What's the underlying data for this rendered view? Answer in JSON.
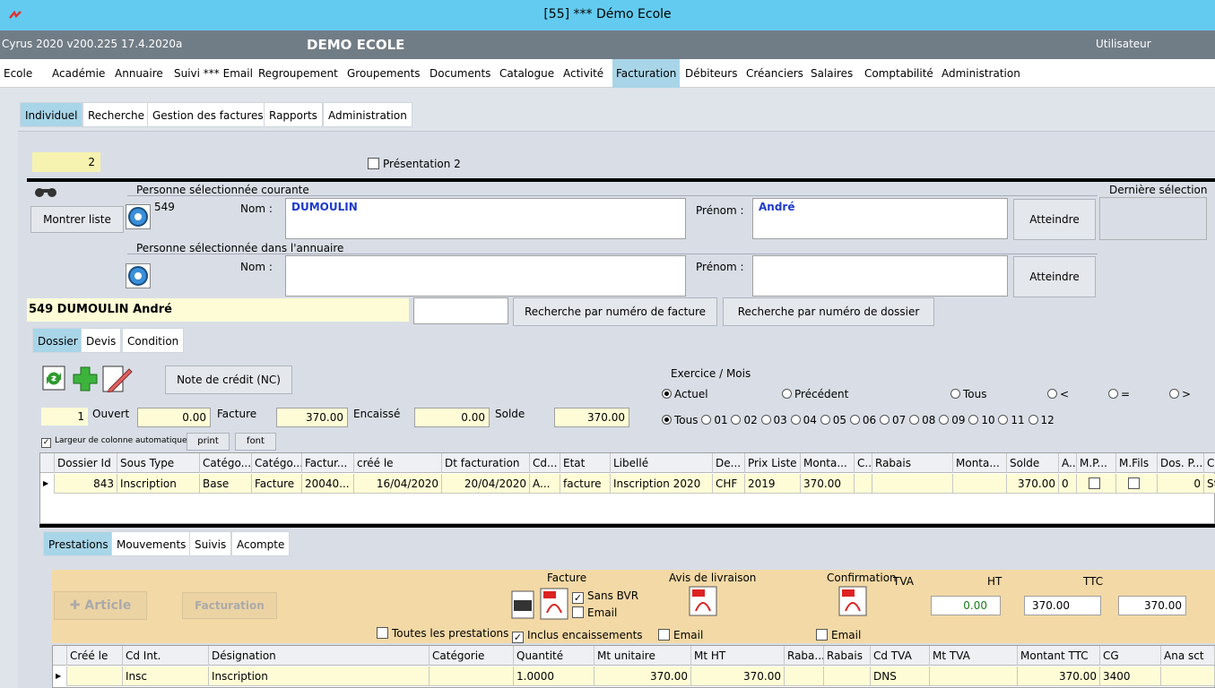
{
  "window": {
    "title": "[55] *** Démo Ecole"
  },
  "app": {
    "version": "Cyrus 2020 v200.225 17.4.2020a",
    "school": "DEMO ECOLE",
    "user": "Utilisateur"
  },
  "menu": [
    "Ecole",
    "Académie",
    "Annuaire",
    "Suivi *** Email",
    "Regroupement",
    "Groupements",
    "Documents",
    "Catalogue",
    "Activité",
    "Facturation",
    "Débiteurs",
    "Créanciers",
    "Salaires",
    "Comptabilité",
    "Administration"
  ],
  "subtabs": [
    "Individuel",
    "Recherche",
    "Gestion des factures",
    "Rapports",
    "Administration"
  ],
  "counter": "2",
  "presentation2": "Présentation 2",
  "current": {
    "group": "Personne sélectionnée courante",
    "id": "549",
    "nom_label": "Nom :",
    "nom": "DUMOULIN",
    "prenom_label": "Prénom :",
    "prenom": "André",
    "goto": "Atteindre",
    "show_list": "Montrer liste"
  },
  "last_selection": "Dernière sélection",
  "annuaire": {
    "group": "Personne sélectionnée dans l'annuaire",
    "nom_label": "Nom :",
    "nom": "",
    "prenom_label": "Prénom :",
    "prenom": "",
    "goto": "Atteindre"
  },
  "person_banner": "549 DUMOULIN André",
  "search_invoice": "Recherche par numéro de facture",
  "search_dossier": "Recherche par numéro de dossier",
  "dtabs": [
    "Dossier",
    "Devis",
    "Condition"
  ],
  "credit_note": "Note de crédit (NC)",
  "summary": {
    "count": "1",
    "ouvert_label": "Ouvert",
    "ouvert": "0.00",
    "facture_label": "Facture",
    "facture": "370.00",
    "encaisse_label": "Encaissé",
    "encaisse": "0.00",
    "solde_label": "Solde",
    "solde": "370.00"
  },
  "exercise": {
    "title": "Exercice / Mois",
    "opts1": [
      "Actuel",
      "Précédent",
      "Tous",
      "<",
      "=",
      ">"
    ],
    "opts2": [
      "Tous",
      "01",
      "02",
      "03",
      "04",
      "05",
      "06",
      "07",
      "08",
      "09",
      "10",
      "11",
      "12"
    ]
  },
  "auto_width": "Largeur de colonne automatique",
  "print": "print",
  "font": "font",
  "grid1": {
    "headers": [
      "Dossier Id",
      "Sous Type",
      "Catégo...",
      "Catégo...",
      "Factur...",
      "créé le",
      "Dt facturation",
      "Cd...",
      "Etat",
      "Libellé",
      "De...",
      "Prix Liste",
      "Monta...",
      "C..",
      "Rabais",
      "Monta...",
      "Solde",
      "A..",
      "M.P...",
      "M.Fils",
      "Dos. P...",
      "Cal..."
    ],
    "rows": [
      [
        "843",
        "Inscription",
        "Base",
        "Facture",
        "20040...",
        "16/04/2020",
        "20/04/2020",
        "A...",
        "facture",
        "Inscription 2020",
        "CHF",
        "2019",
        "370.00",
        "",
        "",
        "",
        "370.00",
        "0",
        "",
        "",
        "0",
        "Stan..."
      ]
    ]
  },
  "ptabs": [
    "Prestations",
    "Mouvements",
    "Suivis",
    "Acompte"
  ],
  "prest": {
    "article": "Article",
    "facturation": "Facturation",
    "all": "Toutes les prestations",
    "facture_group": "Facture",
    "sans_bvr": "Sans BVR",
    "email": "Email",
    "inclus": "Inclus encaissements",
    "avis": "Avis de livraison",
    "email2": "Email",
    "confirmation": "Confirmation",
    "email3": "Email",
    "tva": "TVA",
    "ht_label": "HT",
    "ttc_label": "TTC",
    "tva_val": "0.00",
    "ht_val": "370.00",
    "ttc_val": "370.00"
  },
  "grid2": {
    "headers": [
      "Créé le",
      "Cd Int.",
      "Désignation",
      "Catégorie",
      "Quantité",
      "Mt unitaire",
      "Mt HT",
      "Raba...",
      "Rabais",
      "Cd TVA",
      "Mt TVA",
      "Montant TTC",
      "CG",
      "Ana sct"
    ],
    "rows": [
      [
        "",
        "Insc",
        "Inscription",
        "",
        "1.0000",
        "370.00",
        "370.00",
        "",
        "",
        "DNS",
        "",
        "370.00",
        "3400",
        ""
      ]
    ]
  }
}
